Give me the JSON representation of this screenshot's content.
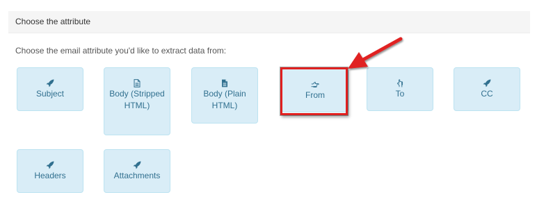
{
  "panel": {
    "title": "Choose the attribute",
    "instructions": "Choose the email attribute you'd like to extract data from:"
  },
  "tiles": [
    {
      "label": "Subject",
      "icon": "rocket-icon"
    },
    {
      "label": "Body (Stripped HTML)",
      "icon": "file-outline-icon"
    },
    {
      "label": "Body (Plain HTML)",
      "icon": "file-filled-icon"
    },
    {
      "label": "From",
      "icon": "hand-point-right-icon"
    },
    {
      "label": "To",
      "icon": "hand-point-up-icon"
    },
    {
      "label": "CC",
      "icon": "rocket-icon"
    },
    {
      "label": "Headers",
      "icon": "rocket-icon"
    },
    {
      "label": "Attachments",
      "icon": "rocket-icon"
    }
  ],
  "colors": {
    "tile_bg": "#d9edf7",
    "tile_text": "#31708f",
    "highlight": "#e02020"
  }
}
